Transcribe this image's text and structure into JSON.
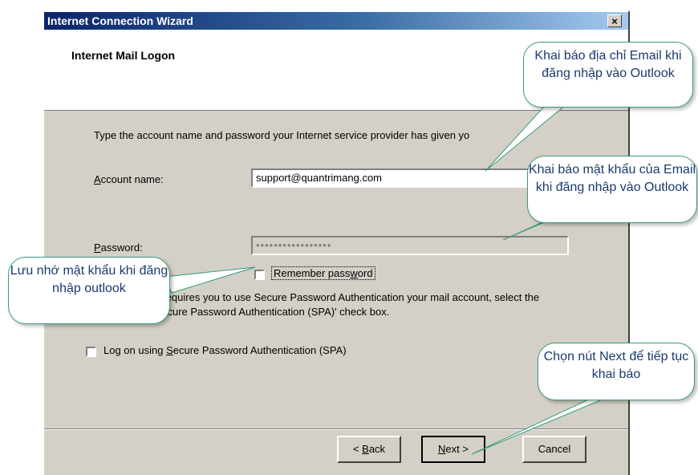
{
  "window": {
    "title": "Internet Connection Wizard",
    "close_label": "×",
    "header_title": "Internet Mail Logon"
  },
  "form": {
    "instruction": "Type the account name and password your Internet service provider has given yo",
    "account_label_mnemonic": "A",
    "account_label_rest": "ccount name:",
    "account_value": "support@quantrimang.com",
    "password_label_mnemonic": "P",
    "password_label_rest": "assword:",
    "password_value": "•••••••••••••••••",
    "remember_before": "Remember pass",
    "remember_mnemonic": "w",
    "remember_after": "ord",
    "remember_checked": false,
    "spa_text": "service provider requires you to use Secure Password Authentication your mail account, select the 'Log On Using Secure Password Authentication (SPA)' check box.",
    "spa_before": "Log on using ",
    "spa_mnemonic": "S",
    "spa_after": "ecure Password Authentication (SPA)",
    "spa_checked": false
  },
  "buttons": {
    "back_prefix": "< ",
    "back_mnemonic": "B",
    "back_rest": "ack",
    "next_mnemonic": "N",
    "next_rest": "ext >",
    "cancel": "Cancel"
  },
  "callouts": {
    "email": "Khai báo địa chỉ Email khi đăng nhập vào Outlook",
    "password": "Khai báo mật khẩu của Email khi đăng nhập vào Outlook",
    "remember": "Lưu nhớ mật khẩu khi đăng nhập outlook",
    "next": "Chọn nút Next để tiếp tục khai báo"
  },
  "colors": {
    "title_bar": "#0a246a",
    "dialog_face": "#d4d0c8",
    "callout_border": "#3a9a7a",
    "callout_text": "#1a3a70"
  }
}
